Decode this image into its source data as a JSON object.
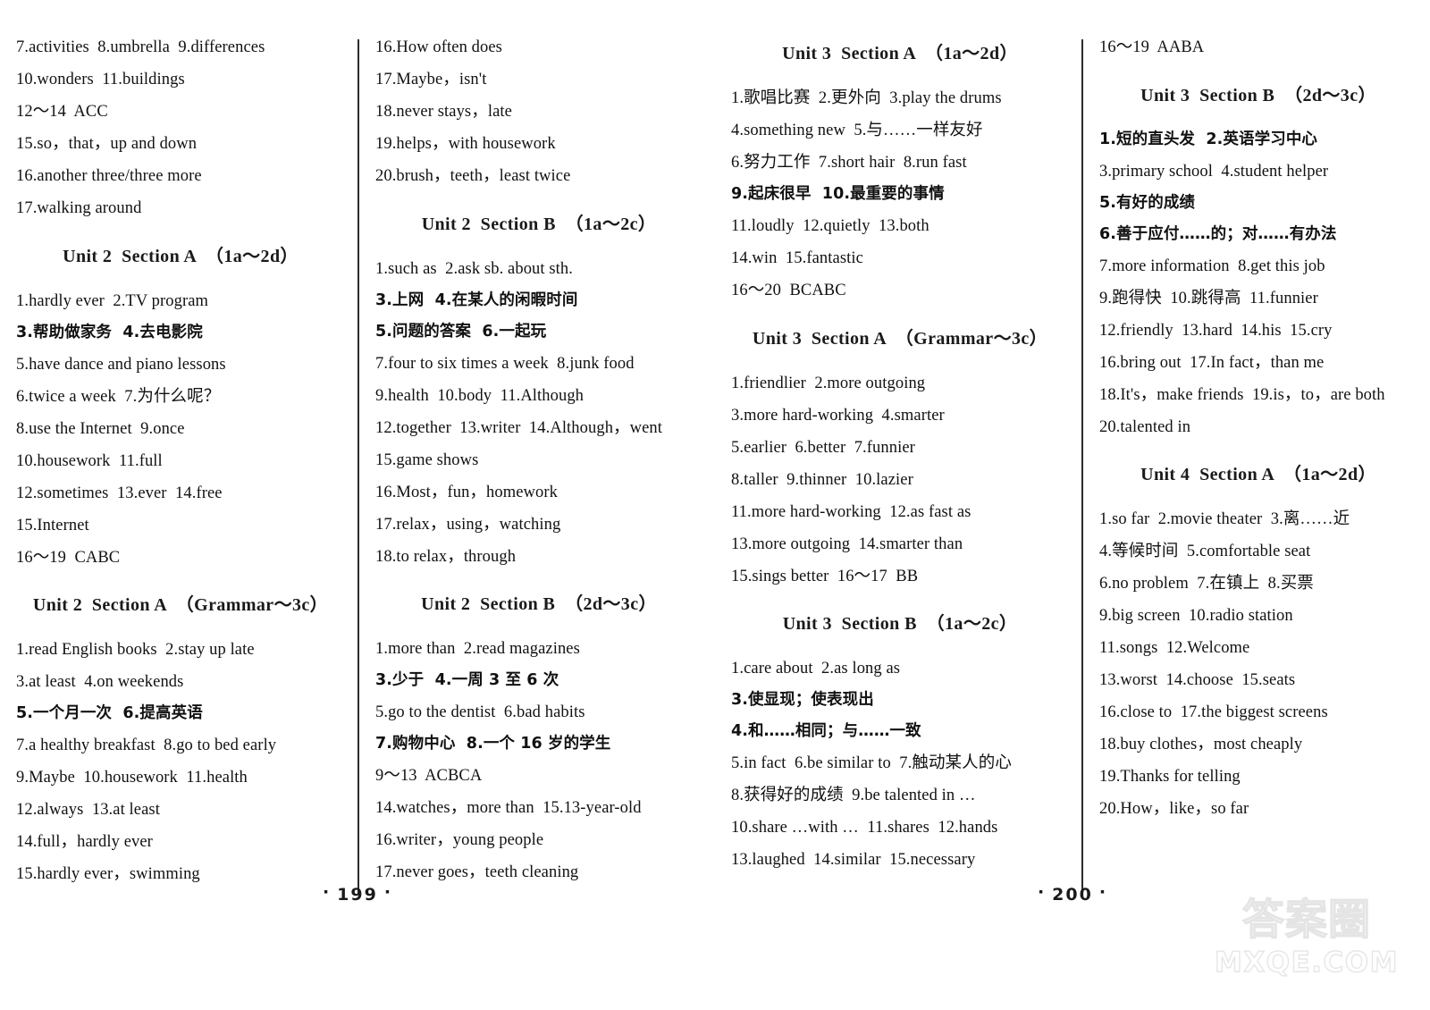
{
  "document": {
    "kind": "answer-key-scan",
    "watermark": {
      "cn": "答案圈",
      "en": "MXQE.COM"
    }
  },
  "pages": [
    {
      "folio": "199",
      "folio_left_dot": "·",
      "folio_right_dot": "·",
      "columns": [
        {
          "blocks": [
            {
              "type": "lines",
              "lines": [
                "7.activities  8.umbrella  9.differences",
                "10.wonders  11.buildings",
                "12～14  ACC",
                "15.so，that，up and down",
                "16.another three/three more",
                "17.walking around"
              ]
            },
            {
              "type": "heading",
              "text": "Unit 2  Section A  （1a～2d）"
            },
            {
              "type": "lines",
              "lines": [
                "1.hardly ever  2.TV program",
                "3.帮助做家务  4.去电影院",
                "5.have dance and piano lessons",
                "6.twice a week  7.为什么呢？",
                "8.use the Internet  9.once",
                "10.housework  11.full",
                "12.sometimes  13.ever  14.free",
                "15.Internet",
                "16～19  CABC"
              ]
            },
            {
              "type": "heading",
              "text": "Unit 2  Section A  （Grammar～3c）"
            },
            {
              "type": "lines",
              "lines": [
                "1.read English books  2.stay up late",
                "3.at least  4.on weekends",
                "5.一个月一次  6.提高英语",
                "7.a healthy breakfast  8.go to bed early",
                "9.Maybe  10.housework  11.health",
                "12.always  13.at least",
                "14.full，hardly ever",
                "15.hardly ever，swimming"
              ]
            }
          ]
        },
        {
          "blocks": [
            {
              "type": "lines",
              "lines": [
                "16.How often does",
                "17.Maybe，isn't",
                "18.never stays，late",
                "19.helps，with housework",
                "20.brush，teeth，least twice"
              ]
            },
            {
              "type": "heading",
              "text": "Unit 2  Section B  （1a～2c）"
            },
            {
              "type": "lines",
              "lines": [
                "1.such as  2.ask sb. about sth.",
                "3.上网  4.在某人的闲暇时间",
                "5.问题的答案  6.一起玩",
                "7.four to six times a week  8.junk food",
                "9.health  10.body  11.Although",
                "12.together  13.writer  14.Although，went",
                "15.game shows",
                "16.Most，fun，homework",
                "17.relax，using，watching",
                "18.to relax，through"
              ]
            },
            {
              "type": "heading",
              "text": "Unit 2  Section B  （2d～3c）"
            },
            {
              "type": "lines",
              "lines": [
                "1.more than  2.read magazines",
                "3.少于  4.一周 3 至 6 次",
                "5.go to the dentist  6.bad habits",
                "7.购物中心  8.一个 16 岁的学生",
                "9～13  ACBCA",
                "14.watches，more than  15.13-year-old",
                "16.writer，young people",
                "17.never goes，teeth cleaning"
              ]
            }
          ]
        }
      ]
    },
    {
      "folio": "200",
      "folio_left_dot": "·",
      "folio_right_dot": "·",
      "columns": [
        {
          "blocks": [
            {
              "type": "heading",
              "text": "Unit 3  Section A  （1a～2d）",
              "first": true
            },
            {
              "type": "lines",
              "lines": [
                "1.歌唱比赛  2.更外向  3.play the drums",
                "4.something new  5.与……一样友好",
                "6.努力工作  7.short hair  8.run fast",
                "9.起床很早  10.最重要的事情",
                "11.loudly  12.quietly  13.both",
                "14.win  15.fantastic",
                "16～20  BCABC"
              ]
            },
            {
              "type": "heading",
              "text": "Unit 3  Section A  （Grammar～3c）"
            },
            {
              "type": "lines",
              "lines": [
                "1.friendlier  2.more outgoing",
                "3.more hard-working  4.smarter",
                "5.earlier  6.better  7.funnier",
                "8.taller  9.thinner  10.lazier",
                "11.more hard-working  12.as fast as",
                "13.more outgoing  14.smarter than",
                "15.sings better  16～17  BB"
              ]
            },
            {
              "type": "heading",
              "text": "Unit 3  Section B  （1a～2c）"
            },
            {
              "type": "lines",
              "lines": [
                "1.care about  2.as long as",
                "3.使显现；使表现出",
                "4.和……相同；与……一致",
                "5.in fact  6.be similar to  7.触动某人的心",
                "8.获得好的成绩  9.be talented in …",
                "10.share …with …  11.shares  12.hands",
                "13.laughed  14.similar  15.necessary"
              ]
            }
          ]
        },
        {
          "blocks": [
            {
              "type": "lines",
              "lines": [
                "16～19  AABA"
              ]
            },
            {
              "type": "heading",
              "text": "Unit 3  Section B  （2d～3c）"
            },
            {
              "type": "lines",
              "lines": [
                "1.短的直头发  2.英语学习中心",
                "3.primary school  4.student helper",
                "5.有好的成绩",
                "6.善于应付……的；对……有办法",
                "7.more information  8.get this job",
                "9.跑得快  10.跳得高  11.funnier",
                "12.friendly  13.hard  14.his  15.cry",
                "16.bring out  17.In fact，than me",
                "18.It's，make friends  19.is，to，are both",
                "20.talented in"
              ]
            },
            {
              "type": "heading",
              "text": "Unit 4  Section A  （1a～2d）"
            },
            {
              "type": "lines",
              "lines": [
                "1.so far  2.movie theater  3.离……近",
                "4.等候时间  5.comfortable seat",
                "6.no problem  7.在镇上  8.买票",
                "9.big screen  10.radio station",
                "11.songs  12.Welcome",
                "13.worst  14.choose  15.seats",
                "16.close to  17.the biggest screens",
                "18.buy clothes，most cheaply",
                "19.Thanks for telling",
                "20.How，like，so far"
              ]
            }
          ]
        }
      ]
    }
  ]
}
